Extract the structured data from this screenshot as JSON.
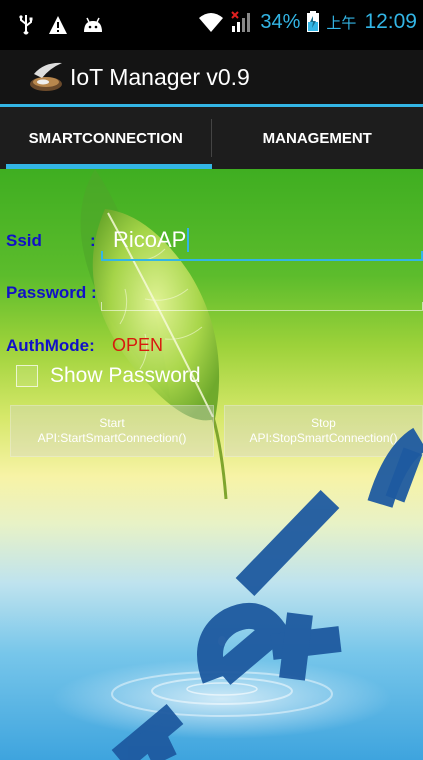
{
  "status_bar": {
    "icons_left": [
      "usb-icon",
      "warning-icon",
      "android-icon"
    ],
    "icons_right": [
      "wifi-icon",
      "signal-icon",
      "battery-icon"
    ],
    "battery_percent": "34%",
    "ampm": "上午",
    "time": "12:09"
  },
  "app": {
    "title": "IoT Manager v0.9",
    "icon": "app-icon"
  },
  "tabs": [
    {
      "label": "SMARTCONNECTION",
      "selected": true
    },
    {
      "label": "MANAGEMENT",
      "selected": false
    }
  ],
  "form": {
    "ssid_label": "Ssid",
    "ssid_colon": ":",
    "ssid_value": "RicoAP",
    "password_label": "Password :",
    "password_value": "",
    "authmode_label": "AuthMode:",
    "authmode_value": "OPEN",
    "show_password_label": "Show Password",
    "show_password_checked": false
  },
  "buttons": {
    "start_title": "Start",
    "start_api": "API:StartSmartConnection()",
    "stop_title": "Stop",
    "stop_api": "API:StopSmartConnection()"
  },
  "watermark": {
    "text": "ek"
  },
  "colors": {
    "accent": "#33b5e5",
    "label_blue": "#1111c8",
    "auth_red": "#d81a0d",
    "watermark": "#1e5aa0"
  }
}
